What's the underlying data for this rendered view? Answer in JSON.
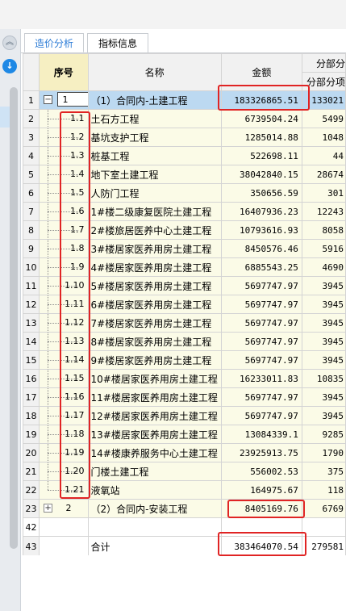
{
  "tabs": [
    {
      "label": "造价分析",
      "active": true
    },
    {
      "label": "指标信息",
      "active": false
    }
  ],
  "headers": {
    "seq": "序号",
    "name": "名称",
    "amount": "金额",
    "part_top": "分部分",
    "part_bottom": "分部分项"
  },
  "rows": [
    {
      "rn": "1",
      "seq": "1",
      "name": "（1）合同内-土建工程",
      "amount": "183326865.51",
      "part": "133021"
    },
    {
      "rn": "2",
      "seq": "1.1",
      "name": "土石方工程",
      "amount": "6739504.24",
      "part": "5499"
    },
    {
      "rn": "3",
      "seq": "1.2",
      "name": "基坑支护工程",
      "amount": "1285014.88",
      "part": "1048"
    },
    {
      "rn": "4",
      "seq": "1.3",
      "name": "桩基工程",
      "amount": "522698.11",
      "part": "44"
    },
    {
      "rn": "5",
      "seq": "1.4",
      "name": "地下室土建工程",
      "amount": "38042840.15",
      "part": "28674"
    },
    {
      "rn": "6",
      "seq": "1.5",
      "name": "人防门工程",
      "amount": "350656.59",
      "part": "301"
    },
    {
      "rn": "7",
      "seq": "1.6",
      "name": "1#楼二级康复医院土建工程",
      "amount": "16407936.23",
      "part": "12243"
    },
    {
      "rn": "8",
      "seq": "1.7",
      "name": "2#楼旅居医养中心土建工程",
      "amount": "10793616.93",
      "part": "8058"
    },
    {
      "rn": "9",
      "seq": "1.8",
      "name": "3#楼居家医养用房土建工程",
      "amount": "8450576.46",
      "part": "5916"
    },
    {
      "rn": "10",
      "seq": "1.9",
      "name": "4#楼居家医养用房土建工程",
      "amount": "6885543.25",
      "part": "4690"
    },
    {
      "rn": "11",
      "seq": "1.10",
      "name": "5#楼居家医养用房土建工程",
      "amount": "5697747.97",
      "part": "3945"
    },
    {
      "rn": "12",
      "seq": "1.11",
      "name": "6#楼居家医养用房土建工程",
      "amount": "5697747.97",
      "part": "3945"
    },
    {
      "rn": "13",
      "seq": "1.12",
      "name": "7#楼居家医养用房土建工程",
      "amount": "5697747.97",
      "part": "3945"
    },
    {
      "rn": "14",
      "seq": "1.13",
      "name": "8#楼居家医养用房土建工程",
      "amount": "5697747.97",
      "part": "3945"
    },
    {
      "rn": "15",
      "seq": "1.14",
      "name": "9#楼居家医养用房土建工程",
      "amount": "5697747.97",
      "part": "3945"
    },
    {
      "rn": "16",
      "seq": "1.15",
      "name": "10#楼居家医养用房土建工程",
      "amount": "16233011.83",
      "part": "10835"
    },
    {
      "rn": "17",
      "seq": "1.16",
      "name": "11#楼居家医养用房土建工程",
      "amount": "5697747.97",
      "part": "3945"
    },
    {
      "rn": "18",
      "seq": "1.17",
      "name": "12#楼居家医养用房土建工程",
      "amount": "5697747.97",
      "part": "3945"
    },
    {
      "rn": "19",
      "seq": "1.18",
      "name": "13#楼居家医养用房土建工程",
      "amount": "13084339.1",
      "part": "9285"
    },
    {
      "rn": "20",
      "seq": "1.19",
      "name": "14#楼康养服务中心土建工程",
      "amount": "23925913.75",
      "part": "1790"
    },
    {
      "rn": "21",
      "seq": "1.20",
      "name": "门楼土建工程",
      "amount": "556002.53",
      "part": "375"
    },
    {
      "rn": "22",
      "seq": "1.21",
      "name": "液氧站",
      "amount": "164975.67",
      "part": "118"
    },
    {
      "rn": "23",
      "seq": "2",
      "name": "（2）合同内-安装工程",
      "amount": "8405169.76",
      "part": "6769"
    },
    {
      "rn": "42",
      "seq": "",
      "name": "",
      "amount": "",
      "part": ""
    },
    {
      "rn": "43",
      "seq": "",
      "name": "合计",
      "amount": "383464070.54",
      "part": "279581"
    }
  ],
  "colors": {
    "selected_row": "#bcd9f1",
    "row_bg": "#fbfbe7",
    "highlight_box": "#e02424",
    "tab_active": "#2b7bd6"
  }
}
